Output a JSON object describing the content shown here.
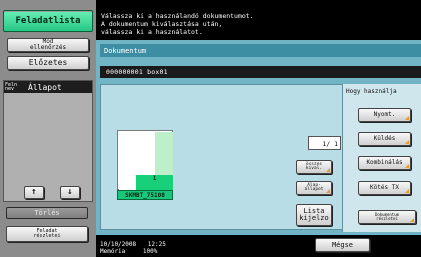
{
  "left": {
    "job_list": "Feladatlista",
    "check_line1": "Mod",
    "check_line2": "ellenőrzés",
    "preview": "Előzetes",
    "table_head_col1_line1": "Feln",
    "table_head_col1_line2": "nev",
    "table_head_col2": "Állapot",
    "up_arrow": "↑",
    "down_arrow": "↓",
    "delete": "Törlés",
    "details_line1": "Feladat",
    "details_line2": "részletei"
  },
  "message": {
    "line1": "Válassza ki a használandó dokumentumot.",
    "line2": "A dokumentum kiválasztása után,",
    "line3": "válassza ki a használatot."
  },
  "main": {
    "title": "Dokumentum",
    "box_info": "000000001  box01",
    "pager": "1/  1",
    "thumb_count": "1",
    "thumb_label": "SKMBT_75108",
    "select_all_line1": "összes",
    "select_all_line2": "kival.",
    "defaults_line1": "Alap-",
    "defaults_line2": "állapot",
    "list_print_line1": "Lista",
    "list_print_line2": "kijelzo"
  },
  "usage": {
    "title": "Hogy használja",
    "print": "Nyomt.",
    "send": "Küldés",
    "combine": "Kombinálás",
    "send_tx": "Kötés TX",
    "doc_details_line1": "Dokumentum",
    "doc_details_line2": "részletei"
  },
  "status": {
    "date": "10/10/2008",
    "time": "12:25",
    "memory_label": "Memória",
    "memory_value": "100%",
    "cancel": "Mégse"
  },
  "colors": {
    "accent_green": "#26c784",
    "panel_teal": "#70b4c6",
    "corner_orange": "#e59a2c"
  }
}
